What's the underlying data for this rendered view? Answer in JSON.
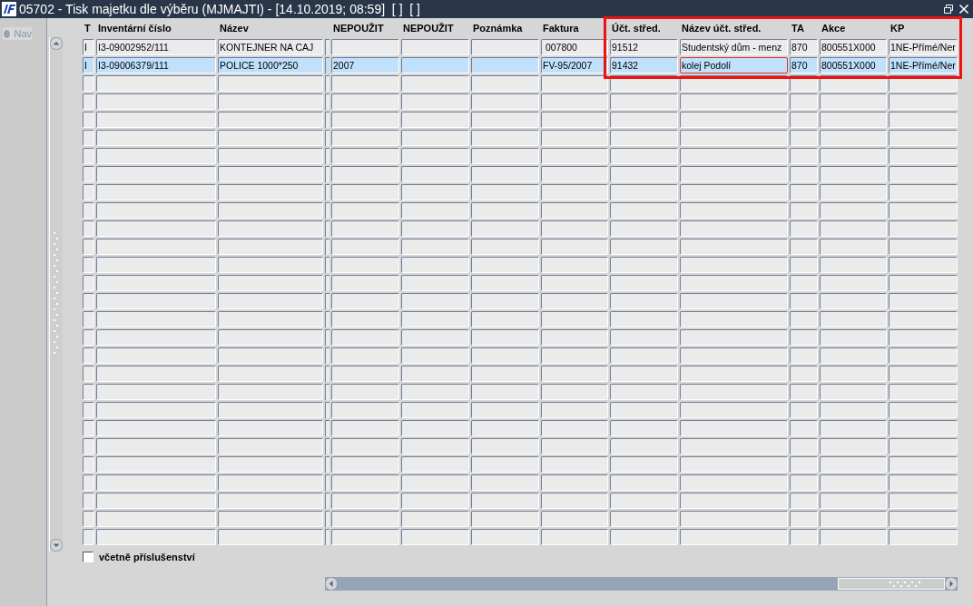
{
  "window": {
    "title": "05702 - Tisk majetku dle výběru (MJMAJTI) - [14.10.2019; 08:59]  [ ]  [ ]"
  },
  "nav_radio": {
    "label": "Nav",
    "disabled": true,
    "selected": false
  },
  "table": {
    "columns": [
      "T",
      "Inventární číslo",
      "Název",
      "NEPOUŽIT",
      "NEPOUŽIT",
      "Poznámka",
      "Faktura",
      "Účt. střed.",
      "Název účt. střed.",
      "TA",
      "Akce",
      "KP"
    ],
    "rows": [
      {
        "selected": false,
        "cells": [
          {
            "text": "I",
            "focused": false
          },
          {
            "text": "I3-09002952/111",
            "focused": false
          },
          {
            "text": "KONTEJNER NA CAJ",
            "focused": false
          },
          {
            "focused": false
          },
          {
            "focused": false
          },
          {
            "focused": false
          },
          {
            "text": " 007800",
            "focused": false
          },
          {
            "text": "91512",
            "focused": false
          },
          {
            "text": "Studentský dům - menz",
            "focused": false
          },
          {
            "text": "870",
            "focused": false
          },
          {
            "text": "800551X000",
            "focused": false
          },
          {
            "text": "1NE-Přímé/Ner",
            "focused": false
          }
        ]
      },
      {
        "selected": true,
        "cells": [
          {
            "text": "I",
            "focused": false
          },
          {
            "text": "I3-09006379/111",
            "focused": false
          },
          {
            "text": "POLICE 1000*250",
            "focused": false
          },
          {
            "text": "2007",
            "focused": false
          },
          {
            "focused": false
          },
          {
            "focused": false
          },
          {
            "text": "FV-95/2007",
            "focused": false
          },
          {
            "text": "91432",
            "focused": false
          },
          {
            "text": "kolej Podolí",
            "focused": true
          },
          {
            "text": "870",
            "focused": false
          },
          {
            "text": "800551X000",
            "focused": false
          },
          {
            "text": "1NE-Přímé/Ner",
            "focused": false
          }
        ]
      }
    ]
  },
  "accessories_checkbox": {
    "label": "včetně příslušenství",
    "checked": false
  }
}
